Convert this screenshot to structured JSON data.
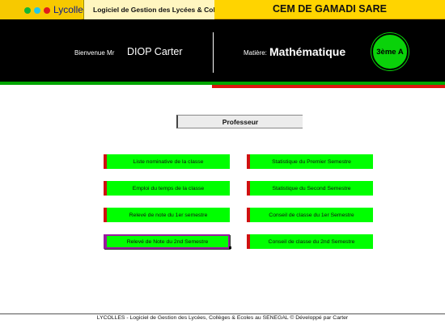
{
  "topbar": {
    "logo_text": "Lycolles",
    "app_title": "Logiciel de Gestion des Lycées & Collèges",
    "school_name": "CEM DE GAMADI SARE",
    "colors": {
      "green_dot": "#13b534",
      "cyan_dot": "#22c8e8",
      "red_dot": "#e11b1b",
      "bar": "#ffd400"
    }
  },
  "header": {
    "welcome_label": "Bienvenue Mr",
    "teacher_name": "DIOP Carter",
    "subject_label": "Matière:",
    "subject_name": "Mathématique",
    "class_badge": "3ème A"
  },
  "role_label": "Professeur",
  "menu": {
    "left": [
      {
        "label": "Liste nominative de la classe"
      },
      {
        "label": "Emploi du temps de la classe"
      },
      {
        "label": "Relevé de note du 1er semestre"
      },
      {
        "label": "Relevé de Note du 2nd Semestre",
        "selected": true
      }
    ],
    "right": [
      {
        "label": "Statistique du Premier Semestre"
      },
      {
        "label": "Statistique du Second Semestre"
      },
      {
        "label": "Conseil de classe du 1er Semestre"
      },
      {
        "label": "Conseil de classe du 2nd Semestre"
      }
    ],
    "colors": {
      "button_bg": "#00ff00",
      "button_accent": "#d01010",
      "selected_border": "#9a1aa0"
    }
  },
  "footer": {
    "text": "LYCOLLES - Logiciel de Gestion des Lycées, Collèges & Ecoles au SENEGAL © Développé par Carter"
  }
}
